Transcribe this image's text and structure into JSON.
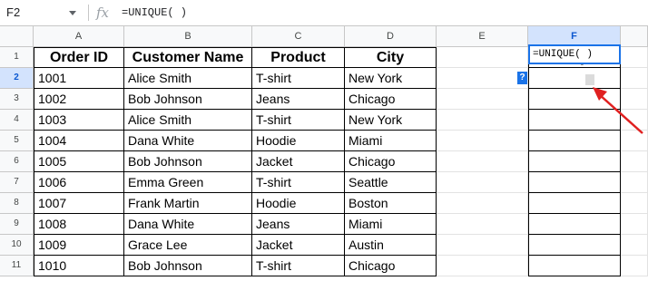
{
  "formula_bar": {
    "cell_ref": "F2",
    "fx_icon": "fx-icon",
    "formula": "=UNIQUE( )"
  },
  "columns": [
    "A",
    "B",
    "C",
    "D",
    "E",
    "F"
  ],
  "rows": [
    "1",
    "2",
    "3",
    "4",
    "5",
    "6",
    "7",
    "8",
    "9",
    "10",
    "11"
  ],
  "table": {
    "headers": [
      "Order ID",
      "Customer Name",
      "Product",
      "City"
    ],
    "rows": [
      [
        "1001",
        "Alice Smith",
        "T-shirt",
        "New York"
      ],
      [
        "1002",
        "Bob Johnson",
        "Jeans",
        "Chicago"
      ],
      [
        "1003",
        "Alice Smith",
        "T-shirt",
        "New York"
      ],
      [
        "1004",
        "Dana White",
        "Hoodie",
        "Miami"
      ],
      [
        "1005",
        "Bob Johnson",
        "Jacket",
        "Chicago"
      ],
      [
        "1006",
        "Emma Green",
        "T-shirt",
        "Seattle"
      ],
      [
        "1007",
        "Frank Martin",
        "Hoodie",
        "Boston"
      ],
      [
        "1008",
        "Dana White",
        "Jeans",
        "Miami"
      ],
      [
        "1009",
        "Grace Lee",
        "Jacket",
        "Austin"
      ],
      [
        "1010",
        "Bob Johnson",
        "T-shirt",
        "Chicago"
      ]
    ]
  },
  "output_column": {
    "header": "City",
    "editing_formula": "=UNIQUE( )",
    "help_label": "?"
  },
  "colors": {
    "selection": "#1a73e8",
    "arrow": "#e02020",
    "header_bg": "#f8f9fa"
  }
}
